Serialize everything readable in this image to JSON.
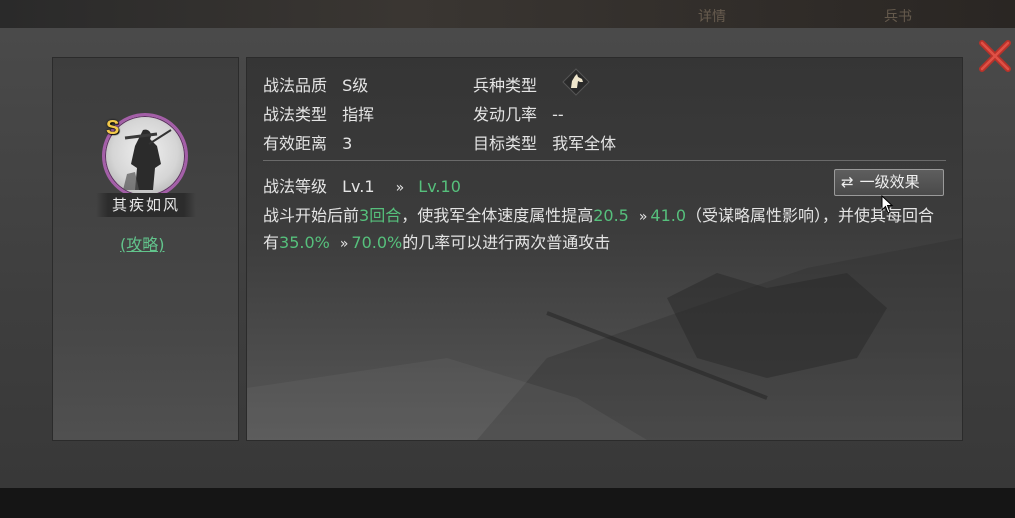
{
  "top_tabs": [
    "详情",
    "兵书"
  ],
  "skill": {
    "name": "其疾如风",
    "grade_badge": "S",
    "strategy_link": "(攻略)"
  },
  "info": {
    "quality_label": "战法品质",
    "quality_value": "S级",
    "troop_label": "兵种类型",
    "troop_icon": "horse-head-icon",
    "type_label": "战法类型",
    "type_value": "指挥",
    "rate_label": "发动几率",
    "rate_value": "--",
    "range_label": "有效距离",
    "range_value": "3",
    "target_label": "目标类型",
    "target_value": "我军全体"
  },
  "level": {
    "label": "战法等级",
    "from": "Lv.1",
    "arrow": "»",
    "to": "Lv.10",
    "effect_button": "一级效果"
  },
  "description": {
    "p1": "战斗开始后前",
    "turns": "3回合",
    "p2": "，使我军全体速度属性提高",
    "speed_from": "20.5",
    "arrow": "»",
    "speed_to": "41.0",
    "p3": "（受谋略属性影响），并使其每回合有",
    "chance_from": "35.0%",
    "chance_to": "70.0%",
    "p4": "的几率可以进行两次普通攻击"
  },
  "colors": {
    "highlight_green": "#56c07c",
    "close_red": "#c0392b",
    "portrait_ring": "#a45fa8",
    "badge_gold": "#f2c84a"
  }
}
